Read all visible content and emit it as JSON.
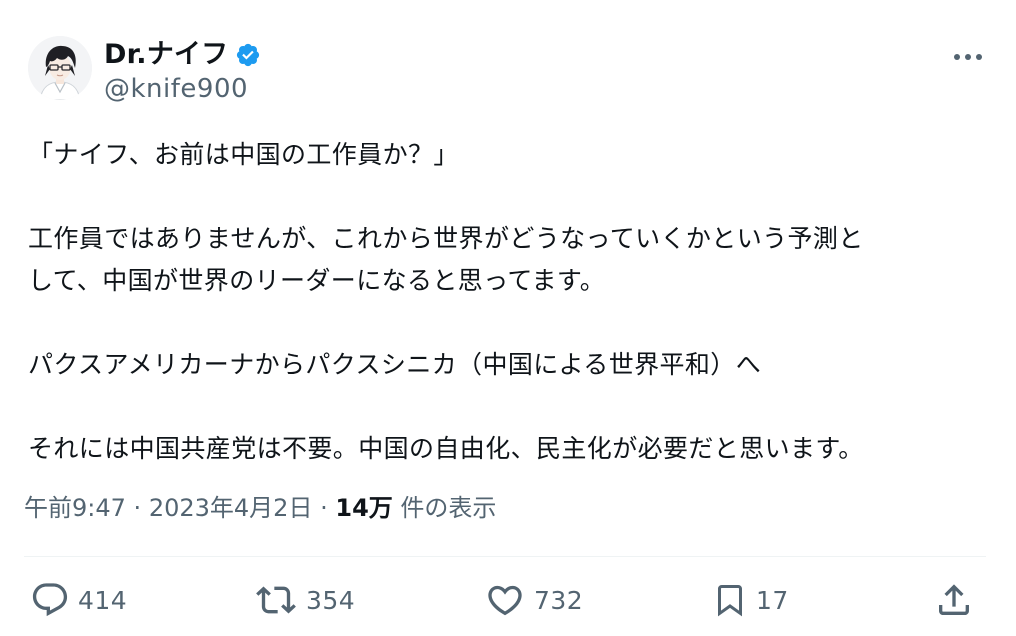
{
  "author": {
    "display_name": "Dr.ナイフ",
    "handle": "@knife900",
    "avatar_icon": "anime-avatar",
    "verified_icon": "verified-badge-icon"
  },
  "tweet": {
    "paragraphs": [
      "「ナイフ、お前は中国の工作員か？」",
      "工作員ではありませんが、これから世界がどうなっていくかという予測と\nして、中国が世界のリーダーになると思ってます。",
      "パクスアメリカーナからパクスシニカ（中国による世界平和）へ",
      "それには中国共産党は不要。中国の自由化、民主化が必要だと思います。"
    ],
    "time": "午前9:47",
    "date": "2023年4月2日",
    "separator": "·",
    "views_count": "14万",
    "views_label": "件の表示"
  },
  "actions": {
    "reply_count": "414",
    "repost_count": "354",
    "like_count": "732",
    "bookmark_count": "17"
  },
  "colors": {
    "text": "#0f1419",
    "secondary": "#536471",
    "verified": "#1d9bf0",
    "divider": "#eff3f4"
  }
}
